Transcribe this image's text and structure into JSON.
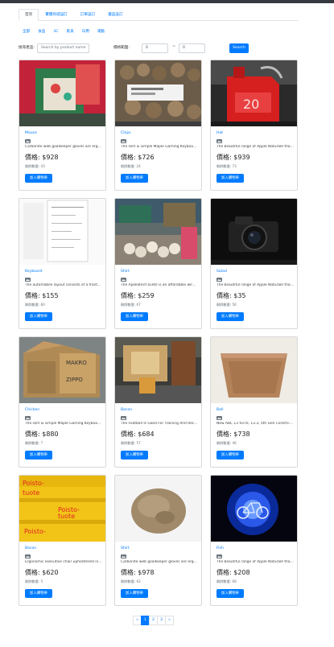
{
  "tabs": [
    {
      "label": "首頁",
      "active": true
    },
    {
      "label": "實體商城設訂",
      "active": false
    },
    {
      "label": "訂單設訂",
      "active": false
    },
    {
      "label": "優品設訂",
      "active": false
    }
  ],
  "categories": [
    "全部",
    "食品",
    "3C",
    "家具",
    "日用",
    "運動"
  ],
  "filter": {
    "search_label": "搜尋產品:",
    "search_placeholder": "Search by product name",
    "price_label": "價格範圍:",
    "min_value": "0",
    "separator": "~",
    "max_value": "0",
    "search_button": "Search"
  },
  "card_action_label": "加入購物車",
  "products": [
    {
      "name": "Mouse",
      "desc": "Carbonite web goalkeeper gloves are ergonomically designed",
      "price": "價格: $928",
      "stock": "剩餘數量: 43"
    },
    {
      "name": "Chips",
      "desc": "The slim & simple Maple Gaming Keyboard from Dev Byte",
      "price": "價格: $726",
      "stock": "剩餘數量: 24"
    },
    {
      "name": "Hat",
      "desc": "The beautiful range of Apple Naturalé that has an exciting mix",
      "price": "價格: $939",
      "stock": "剩餘數量: 73"
    },
    {
      "name": "Keyboard",
      "desc": "The automobile layout consists of a front-engine design",
      "price": "價格: $155",
      "stock": "剩餘數量: 60"
    },
    {
      "name": "Shirt",
      "desc": "The Apollotech B340 is an affordable wireless mouse",
      "price": "價格: $259",
      "stock": "剩餘數量: 67"
    },
    {
      "name": "Salad",
      "desc": "The beautiful range of Apple Naturalé that has an exciting mix",
      "price": "價格: $35",
      "stock": "剩餘數量: 56"
    },
    {
      "name": "Chicken",
      "desc": "The slim & simple Maple Gaming Keyboard from Dev Byte",
      "price": "價格: $880",
      "stock": "剩餘數量: 7"
    },
    {
      "name": "Bacon",
      "desc": "The Football Is Good For Training And Recreational Purposes",
      "price": "價格: $684",
      "stock": "剩餘數量: 57"
    },
    {
      "name": "Ball",
      "desc": "New ABC 13 9370, 13.3, 5th Gen CoreA5-8250U, 8GB RAM",
      "price": "價格: $738",
      "stock": "剩餘數量: 46"
    },
    {
      "name": "Bacon",
      "desc": "Ergonomic executive chair upholstered in bonded black leather",
      "price": "價格: $620",
      "stock": "剩餘數量: 5"
    },
    {
      "name": "Shirt",
      "desc": "Carbonite web goalkeeper gloves are ergonomically designed",
      "price": "價格: $978",
      "stock": "剩餘數量: 62"
    },
    {
      "name": "Fish",
      "desc": "The beautiful range of Apple Naturalé that has an exciting mix",
      "price": "價格: $208",
      "stock": "剩餘數量: 68"
    }
  ],
  "image_text": {
    "box_top": "MAKRO",
    "box_side": "ZIPPO",
    "red_can": "20",
    "yellow_1": "Poisto-",
    "yellow_2": "tuote"
  },
  "pagination": [
    "«",
    "1",
    "2",
    "3",
    "»"
  ],
  "pagination_active": "1",
  "colors": {
    "accent": "#007bff",
    "topbar": "#343a40"
  }
}
